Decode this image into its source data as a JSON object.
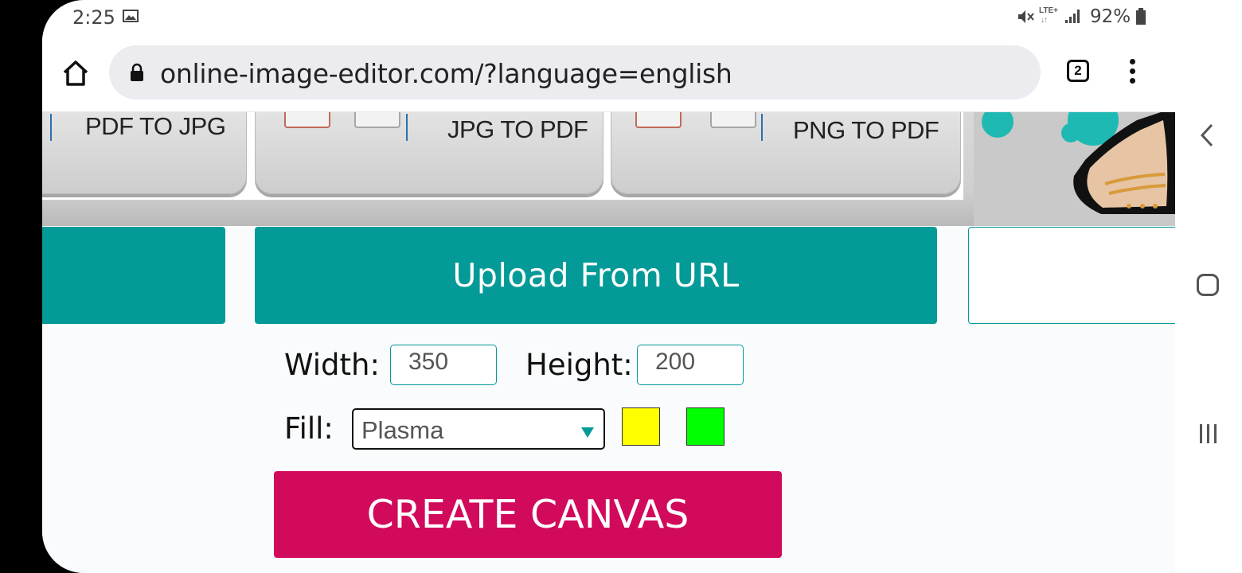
{
  "status_bar": {
    "time": "2:25",
    "network": "LTE+",
    "network_arrows": "↓↑",
    "battery": "92%",
    "icons": [
      "gallery-icon",
      "mute-icon",
      "signal-icon",
      "battery-icon"
    ]
  },
  "browser": {
    "url": "online-image-editor.com/?language=english",
    "tab_count": "2",
    "icons": [
      "home-icon",
      "lock-icon",
      "tabs-icon",
      "more-vert-icon"
    ]
  },
  "banner": {
    "tools": [
      {
        "label": "PDF TO JPG"
      },
      {
        "label": "JPG TO PDF"
      },
      {
        "label": "PNG TO PDF"
      }
    ]
  },
  "upload": {
    "url_button": "Upload From URL"
  },
  "canvas_form": {
    "width_label": "Width:",
    "width_value": "350",
    "height_label": "Height:",
    "height_value": "200",
    "fill_label": "Fill:",
    "fill_selected": "Plasma",
    "color1": "#ffff00",
    "color2": "#00ff00",
    "create_button": "CREATE CANVAS"
  },
  "colors": {
    "teal": "#039a97",
    "create_button": "#d10a5c"
  },
  "android_nav": [
    "back-icon",
    "home-nav-icon",
    "recents-icon"
  ]
}
